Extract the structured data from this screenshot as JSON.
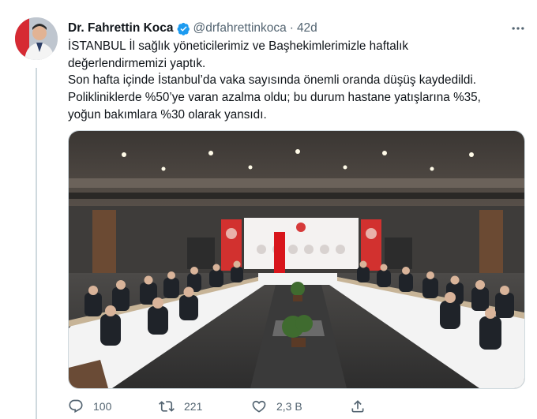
{
  "tweet": {
    "author_name": "Dr. Fahrettin Koca",
    "handle": "@drfahrettinkoca",
    "separator": "·",
    "time": "42d",
    "lines": [
      "İSTANBUL İl sağlık yöneticilerimiz ve Başhekimlerimizle haftalık",
      "değerlendirmemizi yaptık.",
      "Son hafta içinde İstanbul’da vaka sayısında önemli oranda düşüş kaydedildi.",
      "Polikliniklerde %50’ye  varan azalma oldu; bu durum hastane yatışlarına %35,",
      "yoğun bakımlara %30 olarak yansıdı."
    ],
    "verified_color": "#1d9bf0"
  },
  "actions": {
    "reply_count": "100",
    "retweet_count": "221",
    "like_count": "2,3 B"
  },
  "icons": {
    "verified": "verified-badge-icon",
    "more": "more-options-icon",
    "reply": "reply-icon",
    "retweet": "retweet-icon",
    "like": "like-icon",
    "share": "share-icon"
  }
}
